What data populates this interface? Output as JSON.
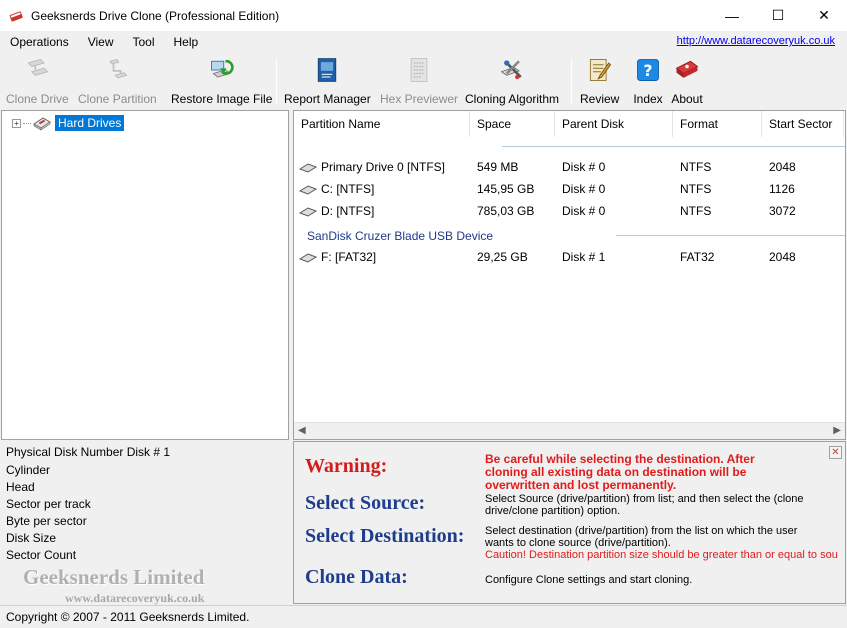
{
  "window": {
    "title": "Geeksnerds Drive Clone (Professional Edition)",
    "minimize": "—",
    "maximize": "☐",
    "close": "✕"
  },
  "menu": {
    "items": [
      "Operations",
      "View",
      "Tool",
      "Help"
    ],
    "link": "http://www.datarecoveryuk.co.uk"
  },
  "toolbar": {
    "clone_drive": "Clone Drive",
    "clone_partition": "Clone Partition",
    "restore_image": "Restore Image File",
    "report_manager": "Report Manager",
    "hex_previewer": "Hex Previewer",
    "cloning_algorithm": "Cloning Algorithm",
    "review": "Review",
    "index": "Index",
    "about": "About"
  },
  "tree": {
    "expander": "+",
    "root_label": "Hard Drives"
  },
  "list": {
    "columns": [
      "Partition Name",
      "Space",
      "Parent Disk",
      "Format",
      "Start Sector"
    ],
    "group2_title": "SanDisk Cruzer Blade USB Device",
    "rows": [
      {
        "name": "Primary Drive 0 [NTFS]",
        "space": "549 MB",
        "disk": "Disk # 0",
        "format": "NTFS",
        "start": "2048"
      },
      {
        "name": "C:  [NTFS]",
        "space": "145,95 GB",
        "disk": "Disk # 0",
        "format": "NTFS",
        "start": "1126"
      },
      {
        "name": "D:  [NTFS]",
        "space": "785,03 GB",
        "disk": "Disk # 0",
        "format": "NTFS",
        "start": "3072"
      },
      {
        "name": "F:  [FAT32]",
        "space": "29,25 GB",
        "disk": "Disk # 1",
        "format": "FAT32",
        "start": "2048"
      }
    ],
    "scroll_left": "◀",
    "scroll_right": "▶"
  },
  "info": {
    "lines": [
      "Physical Disk Number Disk # 1",
      "Cylinder",
      "Head",
      "Sector per track",
      "Byte per sector",
      "Disk Size",
      "Sector Count"
    ],
    "brand": "Geeksnerds Limited",
    "brand_url": "www.datarecoveryuk.co.uk"
  },
  "help": {
    "close": "✕",
    "warning_h": "Warning:",
    "warning_t": [
      "Be careful while selecting the destination. After",
      "cloning all existing data on destination will be",
      "overwritten and lost permanently."
    ],
    "source_h": "Select Source:",
    "source_t": [
      "Select Source (drive/partition) from list; and then select the (clone",
      "drive/clone partition) option."
    ],
    "dest_h": "Select Destination:",
    "dest_t": [
      "Select destination (drive/partition) from the list on which the user",
      "wants to clone source (drive/partition)."
    ],
    "dest_caution": "Caution! Destination partition size should be greater than or equal to sou",
    "clone_h": "Clone Data:",
    "clone_t": "Configure Clone settings and start cloning."
  },
  "status": {
    "text": "Copyright © 2007 - 2011 Geeksnerds Limited."
  }
}
